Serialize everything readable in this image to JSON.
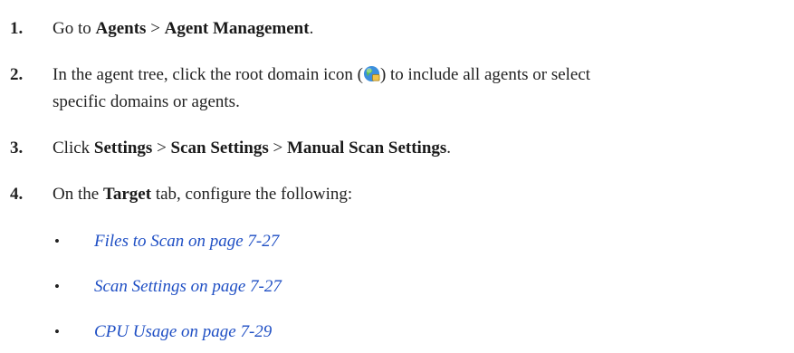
{
  "steps": [
    {
      "number": "1.",
      "pre": "Go to ",
      "b1": "Agents",
      "sep": " > ",
      "b2": "Agent Management",
      "post": "."
    },
    {
      "number": "2.",
      "pre": "In the agent tree, click the root domain icon (",
      "post": ") to include all agents or select",
      "line2": "specific domains or agents.",
      "icon": "root-domain-globe-icon"
    },
    {
      "number": "3.",
      "pre": "Click ",
      "b1": "Settings",
      "sep1": " > ",
      "b2": "Scan Settings",
      "sep2": " > ",
      "b3": "Manual Scan Settings",
      "post": "."
    },
    {
      "number": "4.",
      "pre": "On the ",
      "b1": "Target",
      "post": " tab, configure the following:"
    }
  ],
  "links": [
    {
      "bullet": "•",
      "label": "Files to Scan on page 7-27"
    },
    {
      "bullet": "•",
      "label": "Scan Settings on page 7-27"
    },
    {
      "bullet": "•",
      "label": "CPU Usage on page 7-29"
    }
  ],
  "colors": {
    "link": "#1f4fc4",
    "text": "#222222"
  }
}
